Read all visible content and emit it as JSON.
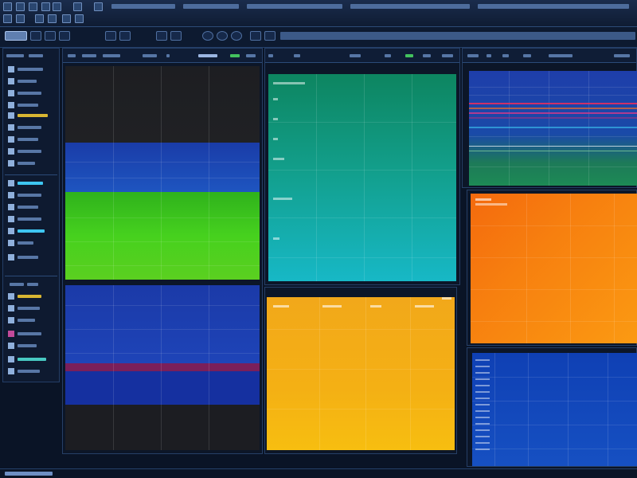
{
  "colors": {
    "chrome": "#0f1c33",
    "accent_green": "#43c25e",
    "accent_yellow": "#d8b632"
  },
  "toolbar": {
    "tools": [
      "new-icon",
      "open-icon",
      "save-icon",
      "undo-icon",
      "redo-icon",
      "zoom-icon",
      "refresh-icon",
      "settings-icon"
    ]
  },
  "sidebar": {
    "items": [
      {
        "icon": "layer-icon"
      },
      {
        "icon": "layer-icon"
      },
      {
        "icon": "layer-icon"
      },
      {
        "icon": "layer-icon"
      },
      {
        "icon": "layer-icon"
      },
      {
        "icon": "layer-icon"
      },
      {
        "icon": "layer-icon"
      },
      {
        "icon": "layer-icon"
      },
      {
        "icon": "layer-icon"
      },
      {
        "icon": "layer-icon"
      },
      {
        "icon": "layer-icon"
      },
      {
        "icon": "layer-icon"
      }
    ]
  },
  "panels": {
    "p1": {
      "band_colors": [
        "#1e1e22",
        "#1a3ca8",
        "#35c21a",
        "#123aa8",
        "#0c1a3a"
      ]
    },
    "p2": {
      "band_colors": [
        "#0f8a64",
        "#17b6c8"
      ]
    },
    "p3": {
      "band_colors": [
        "#f2a81a",
        "#f7be10"
      ]
    },
    "p4": {
      "band_colors": [
        "#1c3fa8",
        "#1d8a55"
      ]
    },
    "p5": {
      "band_colors": [
        "#f56a0d",
        "#fb9a12"
      ]
    },
    "p6": {
      "band_colors": [
        "#0f43b8",
        "#1b57c8"
      ]
    }
  }
}
